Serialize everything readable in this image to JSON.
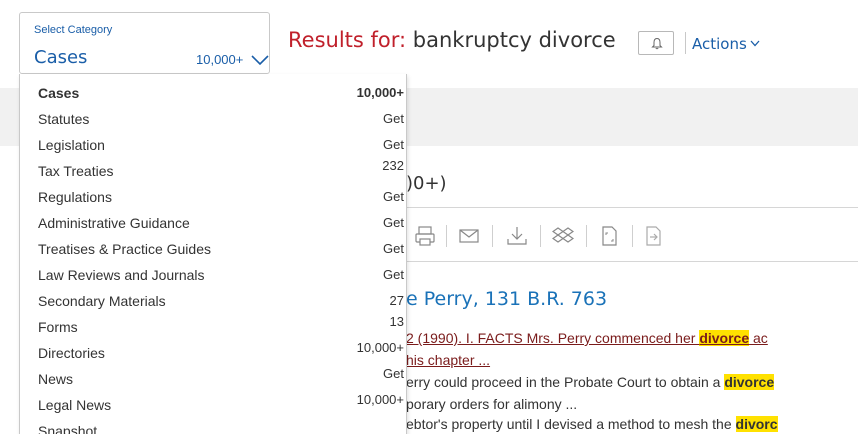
{
  "category_selector": {
    "label": "Select Category",
    "value": "Cases",
    "count": "10,000+"
  },
  "results": {
    "prefix": "Results for:",
    "query": "bankruptcy divorce"
  },
  "actions_label": "Actions",
  "background": {
    "count_fragment": ")0+)",
    "result_title": "e Perry, 131 B.R. 763",
    "snippet_line1_pre": "2 (1990). I. FACTS Mrs. Perry commenced her ",
    "snippet_line1_hl": "divorce",
    "snippet_line1_post": " ac",
    "snippet_line2": "his chapter ...",
    "snippet_line3_pre": "erry could proceed in the Probate Court to obtain a ",
    "snippet_line3_hl": "divorce",
    "snippet_line4": "porary orders for alimony ...",
    "snippet_line5_pre": "ebtor's property until I devised a method to mesh the ",
    "snippet_line5_hl": "divorc"
  },
  "dropdown": {
    "items": [
      {
        "name": "Cases",
        "count": "10,000+",
        "selected": true
      },
      {
        "name": "Statutes",
        "count": "Get"
      },
      {
        "name": "Legislation",
        "count": "Get"
      },
      {
        "name": "Tax Treaties",
        "count": "232"
      },
      {
        "name": "Regulations",
        "count": "Get"
      },
      {
        "name": "Administrative Guidance",
        "count": "Get"
      },
      {
        "name": "Treatises & Practice Guides",
        "count": "Get"
      },
      {
        "name": "Law Reviews and Journals",
        "count": "Get"
      },
      {
        "name": "Secondary Materials",
        "count": "27"
      },
      {
        "name": "Forms",
        "count": "13"
      },
      {
        "name": "Directories",
        "count": "10,000+"
      },
      {
        "name": "News",
        "count": "Get"
      },
      {
        "name": "Legal News",
        "count": "10,000+"
      },
      {
        "name": "Snapshot",
        "count": ""
      }
    ]
  },
  "icons": {
    "chevron": "chevron-down-icon",
    "bell": "bell-icon",
    "toolbar": [
      "print-icon",
      "email-icon",
      "download-icon",
      "dropbox-icon",
      "expand-icon",
      "export-icon"
    ]
  },
  "colors": {
    "link_blue": "#1a5ea8",
    "results_red": "#c0202b",
    "highlight": "#ffe100"
  }
}
